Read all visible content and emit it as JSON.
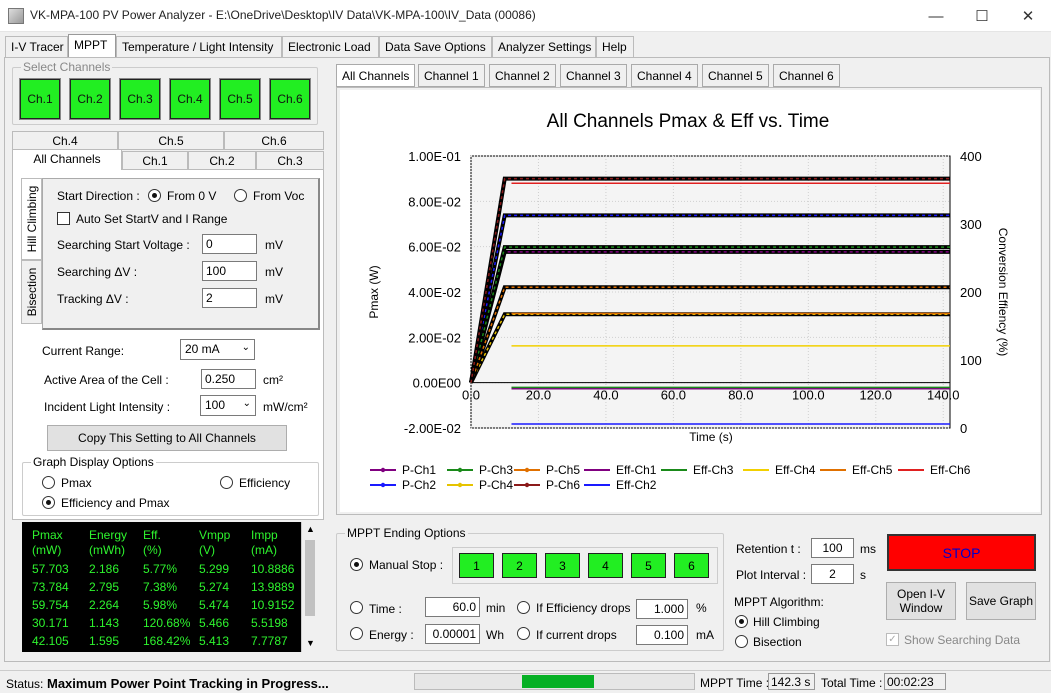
{
  "window": {
    "title": "VK-MPA-100 PV Power Analyzer - E:\\OneDrive\\Desktop\\IV Data\\VK-MPA-100\\IV_Data (00086)"
  },
  "menu_tabs": [
    "I-V Tracer",
    "MPPT",
    "Temperature / Light Intensity",
    "Electronic Load",
    "Data Save Options",
    "Analyzer Settings",
    "Help"
  ],
  "select_channels": {
    "title": "Select Channels",
    "buttons": [
      "Ch.1",
      "Ch.2",
      "Ch.3",
      "Ch.4",
      "Ch.5",
      "Ch.6"
    ]
  },
  "settings_tabs": {
    "row1": [
      "Ch.4",
      "Ch.5",
      "Ch.6"
    ],
    "row2": [
      "All Channels",
      "Ch.1",
      "Ch.2",
      "Ch.3"
    ]
  },
  "side_tabs": [
    "Hill Climbing",
    "Bisection"
  ],
  "hill": {
    "start_direction_label": "Start Direction :",
    "from_0v": "From 0 V",
    "from_voc": "From Voc",
    "auto_set": "Auto Set StartV and I Range",
    "search_start_label": "Searching Start Voltage :",
    "search_start_value": "0",
    "search_dv_label": "Searching ΔV :",
    "search_dv_value": "100",
    "track_dv_label": "Tracking ΔV :",
    "track_dv_value": "2",
    "unit_mv": "mV"
  },
  "cell": {
    "current_range_label": "Current Range:",
    "current_range_value": "20 mA",
    "area_label": "Active Area of the Cell :",
    "area_value": "0.250",
    "area_unit": "cm²",
    "light_label": "Incident Light Intensity :",
    "light_value": "100",
    "light_unit": "mW/cm²",
    "copy_button": "Copy This Setting to All Channels"
  },
  "graph_display": {
    "title": "Graph Display Options",
    "pmax": "Pmax",
    "efficiency": "Efficiency",
    "both": "Efficiency and Pmax"
  },
  "data_table": {
    "headers": [
      [
        "Pmax",
        "(mW)"
      ],
      [
        "Energy",
        "(mWh)"
      ],
      [
        "Eff.",
        "(%)"
      ],
      [
        "Vmpp",
        "(V)"
      ],
      [
        "Impp",
        "(mA)"
      ]
    ],
    "rows": [
      [
        "57.703",
        "2.186",
        "5.77%",
        "5.299",
        "10.8886"
      ],
      [
        "73.784",
        "2.795",
        "7.38%",
        "5.274",
        "13.9889"
      ],
      [
        "59.754",
        "2.264",
        "5.98%",
        "5.474",
        "10.9152"
      ],
      [
        "30.171",
        "1.143",
        "120.68%",
        "5.466",
        "5.5198"
      ],
      [
        "42.105",
        "1.595",
        "168.42%",
        "5.413",
        "7.7787"
      ]
    ]
  },
  "chart_tabs": [
    "All Channels",
    "Channel 1",
    "Channel 2",
    "Channel 3",
    "Channel 4",
    "Channel 5",
    "Channel 6"
  ],
  "chart_data": {
    "type": "line",
    "title": "All Channels Pmax & Eff vs. Time",
    "xlabel": "Time (s)",
    "ylabel": "Pmax (W)",
    "y2label": "Conversion Effiency (%)",
    "xlim": [
      0,
      142
    ],
    "ylim": [
      -0.02,
      0.1
    ],
    "y2lim": [
      0,
      400
    ],
    "xticks": [
      "0.0",
      "20.0",
      "40.0",
      "60.0",
      "80.0",
      "100.0",
      "120.0",
      "140.0"
    ],
    "yticks": [
      "1.00E-01",
      "8.00E-02",
      "6.00E-02",
      "4.00E-02",
      "2.00E-02",
      "0.00E00",
      "-2.00E-02"
    ],
    "y2ticks": [
      "400",
      "300",
      "200",
      "100",
      "0"
    ],
    "grid": true,
    "legend_position": "bottom",
    "series": [
      {
        "name": "P-Ch1",
        "axis": "left",
        "color": "#800080",
        "ramp": [
          0,
          10
        ],
        "value": 0.0577
      },
      {
        "name": "P-Ch2",
        "axis": "left",
        "color": "#1a1aff",
        "ramp": [
          0,
          10
        ],
        "value": 0.0738
      },
      {
        "name": "P-Ch3",
        "axis": "left",
        "color": "#1a8a1a",
        "ramp": [
          0,
          10
        ],
        "value": 0.0598
      },
      {
        "name": "P-Ch4",
        "axis": "left",
        "color": "#e6c300",
        "ramp": [
          0,
          10
        ],
        "value": 0.0302
      },
      {
        "name": "P-Ch5",
        "axis": "left",
        "color": "#e07000",
        "ramp": [
          0,
          10
        ],
        "value": 0.0421
      },
      {
        "name": "P-Ch6",
        "axis": "left",
        "color": "#8b1a1a",
        "ramp": [
          0,
          10
        ],
        "value": 0.09
      },
      {
        "name": "Eff-Ch1",
        "axis": "right",
        "color": "#800080",
        "start": 12,
        "value": 57.7
      },
      {
        "name": "Eff-Ch2",
        "axis": "right",
        "color": "#1a1aff",
        "start": 12,
        "value": 5.8
      },
      {
        "name": "Eff-Ch3",
        "axis": "right",
        "color": "#1a8a1a",
        "start": 12,
        "value": 59.8
      },
      {
        "name": "Eff-Ch4",
        "axis": "right",
        "color": "#f2d000",
        "start": 12,
        "value": 120.7
      },
      {
        "name": "Eff-Ch5",
        "axis": "right",
        "color": "#e07000",
        "start": 12,
        "value": 168.4
      },
      {
        "name": "Eff-Ch6",
        "axis": "right",
        "color": "#e02020",
        "start": 12,
        "value": 360
      }
    ]
  },
  "ending": {
    "title": "MPPT Ending Options",
    "manual_stop": "Manual Stop :",
    "stop_buttons": [
      "1",
      "2",
      "3",
      "4",
      "5",
      "6"
    ],
    "time_label": "Time :",
    "time_value": "60.0",
    "time_unit": "min",
    "eff_drop_label": "If Efficiency drops",
    "eff_drop_value": "1.000",
    "eff_drop_unit": "%",
    "energy_label": "Energy :",
    "energy_value": "0.00001",
    "energy_unit": "Wh",
    "cur_drop_label": "If current drops",
    "cur_drop_value": "0.100",
    "cur_drop_unit": "mA"
  },
  "right_controls": {
    "retention_label": "Retention t :",
    "retention_value": "100",
    "retention_unit": "ms",
    "plot_label": "Plot Interval :",
    "plot_value": "2",
    "plot_unit": "s",
    "algo_title": "MPPT Algorithm:",
    "algo_hill": "Hill Climbing",
    "algo_bisection": "Bisection",
    "stop_button": "STOP",
    "open_iv": "Open I-V Window",
    "save_graph": "Save Graph",
    "show_search": "Show Searching Data"
  },
  "status": {
    "label": "Status:",
    "text": "Maximum Power Point Tracking in Progress...",
    "progress": 0.45,
    "mppt_time_label": "MPPT Time :",
    "mppt_time_value": "142.3 s",
    "total_time_label": "Total Time :",
    "total_time_value": "00:02:23"
  },
  "colors": {
    "channel_green": "#22ee22",
    "stop_red": "#ff0000",
    "stop_text": "#0000cc",
    "data_green": "#2ef42e"
  }
}
